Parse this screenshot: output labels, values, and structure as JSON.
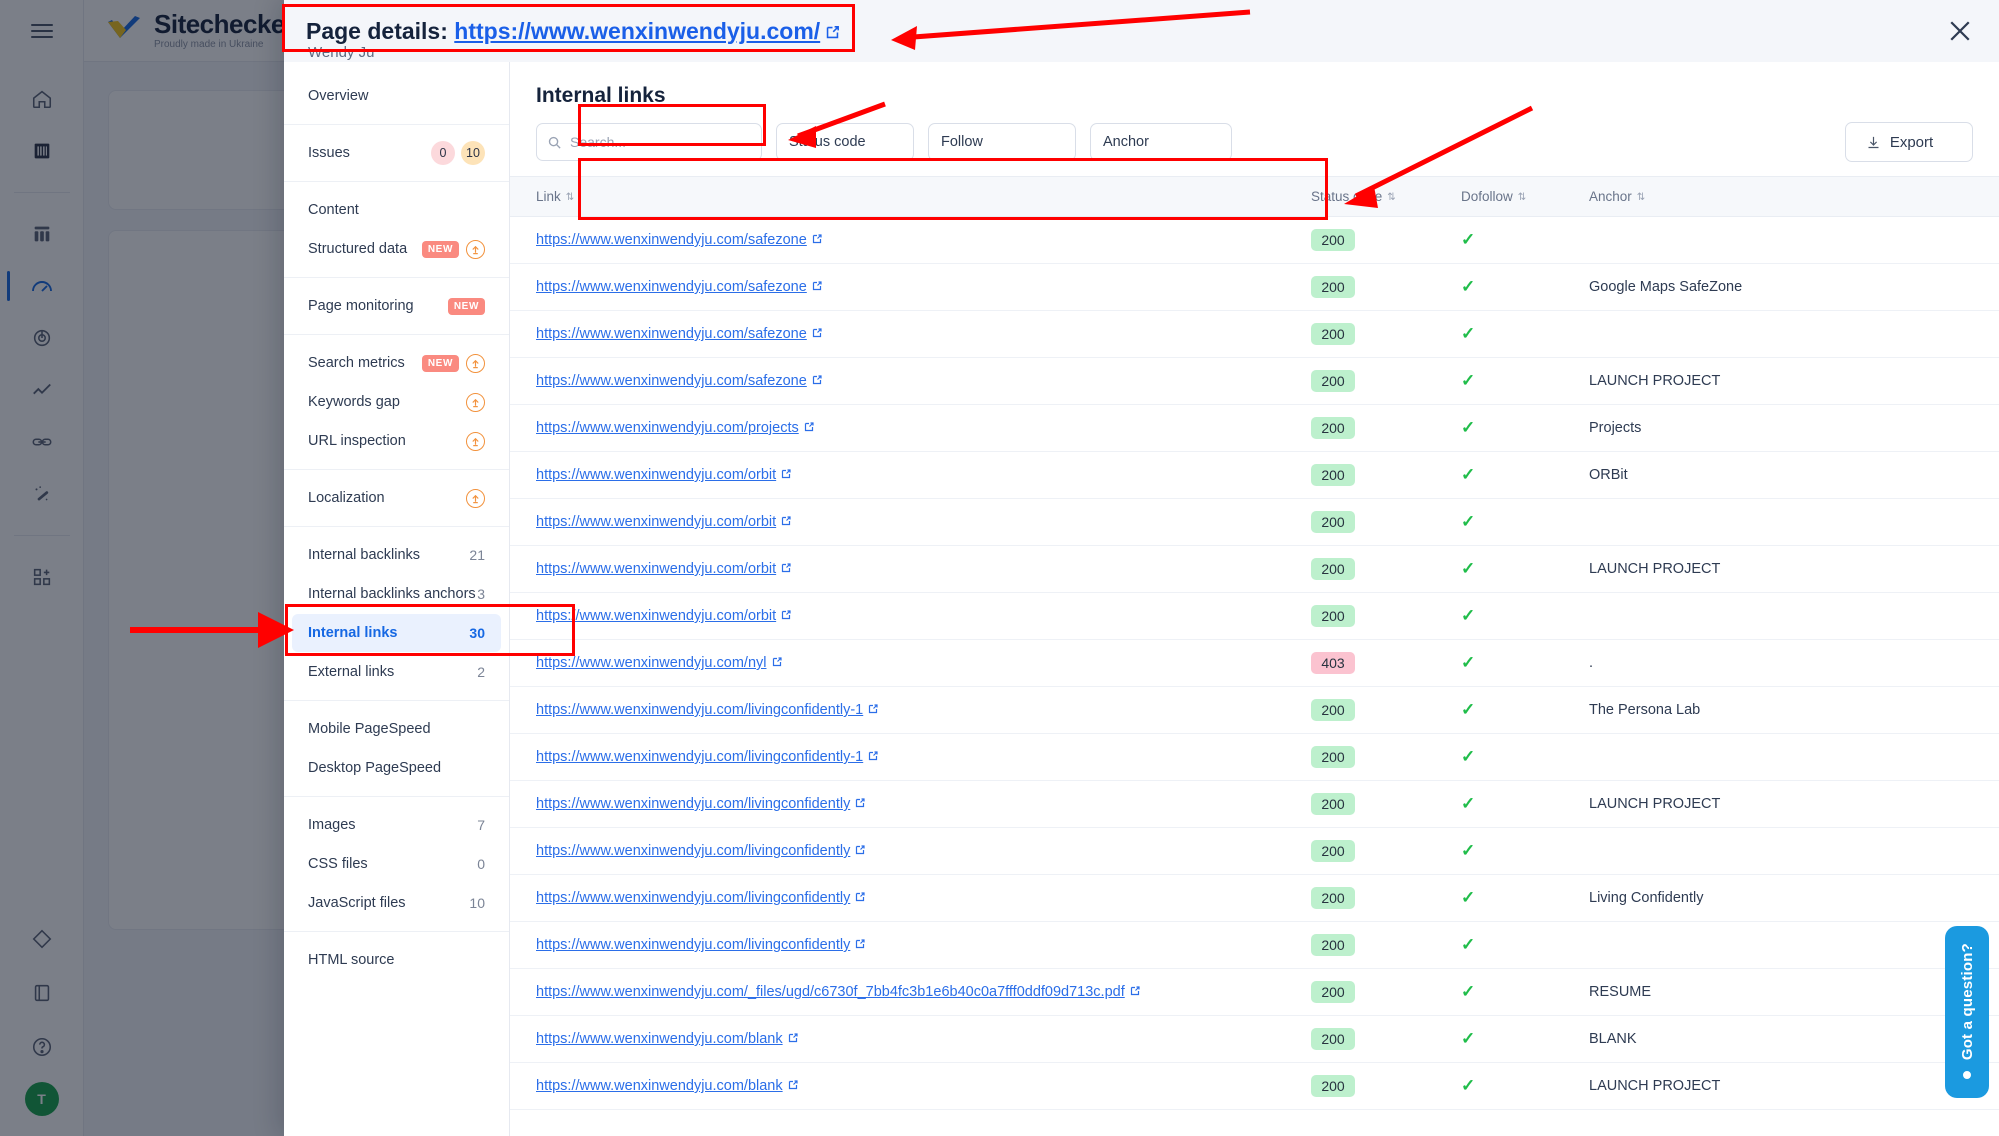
{
  "app": {
    "brand_name": "Sitechecker",
    "brand_tagline": "Proudly made in Ukraine",
    "menu_icon": "hamburger-icon",
    "avatar_initial": "T",
    "rail_icons": [
      "home-icon",
      "barcode-icon",
      "columns-icon",
      "speedometer-icon",
      "target-icon",
      "trend-line-icon",
      "link-icon",
      "magic-wand-icon",
      "add-module-icon",
      "diamond-icon",
      "book-icon",
      "help-icon"
    ]
  },
  "modal": {
    "title_prefix": "Page details:",
    "url": "https://www.wenxinwendyju.com/",
    "external_icon": "external-link-icon",
    "subtitle": "Wendy Ju",
    "close_icon": "close-icon"
  },
  "sidebar": {
    "groups": [
      {
        "items": [
          {
            "label": "Overview"
          }
        ]
      },
      {
        "items": [
          {
            "label": "Issues",
            "badges": [
              {
                "value": "0",
                "color": "#fcd9dc"
              },
              {
                "value": "10",
                "color": "#fde3b8"
              }
            ]
          }
        ]
      },
      {
        "items": [
          {
            "label": "Content"
          },
          {
            "label": "Structured data",
            "tag": "NEW",
            "upgrade": true
          }
        ]
      },
      {
        "items": [
          {
            "label": "Page monitoring",
            "tag": "NEW"
          }
        ]
      },
      {
        "items": [
          {
            "label": "Search metrics",
            "tag": "NEW",
            "upgrade": true
          },
          {
            "label": "Keywords gap",
            "upgrade": true
          },
          {
            "label": "URL inspection",
            "upgrade": true
          }
        ]
      },
      {
        "items": [
          {
            "label": "Localization",
            "upgrade": true
          }
        ]
      },
      {
        "items": [
          {
            "label": "Internal backlinks",
            "count": "21"
          },
          {
            "label": "Internal backlinks anchors",
            "count": "3"
          },
          {
            "label": "Internal links",
            "count": "30",
            "active": true
          },
          {
            "label": "External links",
            "count": "2"
          }
        ]
      },
      {
        "items": [
          {
            "label": "Mobile PageSpeed"
          },
          {
            "label": "Desktop PageSpeed"
          }
        ]
      },
      {
        "items": [
          {
            "label": "Images",
            "count": "7"
          },
          {
            "label": "CSS files",
            "count": "0"
          },
          {
            "label": "JavaScript files",
            "count": "10"
          }
        ]
      },
      {
        "items": [
          {
            "label": "HTML source"
          }
        ]
      }
    ]
  },
  "main": {
    "title": "Internal links",
    "search_placeholder": "Search...",
    "search_value": "",
    "search_icon": "search-icon",
    "filters": [
      {
        "label": "Status code",
        "name": "status-code-filter"
      },
      {
        "label": "Follow",
        "name": "follow-filter"
      },
      {
        "label": "Anchor",
        "name": "anchor-filter"
      }
    ],
    "export_label": "Export",
    "export_icon": "download-icon",
    "columns": [
      {
        "label": "Link",
        "key": "link"
      },
      {
        "label": "Status code",
        "key": "status"
      },
      {
        "label": "Dofollow",
        "key": "dofollow"
      },
      {
        "label": "Anchor",
        "key": "anchor"
      }
    ],
    "rows": [
      {
        "link": "https://www.wenxinwendyju.com/safezone",
        "status": "200",
        "dofollow": true,
        "anchor": ""
      },
      {
        "link": "https://www.wenxinwendyju.com/safezone",
        "status": "200",
        "dofollow": true,
        "anchor": "Google Maps SafeZone"
      },
      {
        "link": "https://www.wenxinwendyju.com/safezone",
        "status": "200",
        "dofollow": true,
        "anchor": ""
      },
      {
        "link": "https://www.wenxinwendyju.com/safezone",
        "status": "200",
        "dofollow": true,
        "anchor": "LAUNCH PROJECT"
      },
      {
        "link": "https://www.wenxinwendyju.com/projects",
        "status": "200",
        "dofollow": true,
        "anchor": "Projects"
      },
      {
        "link": "https://www.wenxinwendyju.com/orbit",
        "status": "200",
        "dofollow": true,
        "anchor": "ORBit"
      },
      {
        "link": "https://www.wenxinwendyju.com/orbit",
        "status": "200",
        "dofollow": true,
        "anchor": ""
      },
      {
        "link": "https://www.wenxinwendyju.com/orbit",
        "status": "200",
        "dofollow": true,
        "anchor": "LAUNCH PROJECT"
      },
      {
        "link": "https://www.wenxinwendyju.com/orbit",
        "status": "200",
        "dofollow": true,
        "anchor": ""
      },
      {
        "link": "https://www.wenxinwendyju.com/nyl",
        "status": "403",
        "dofollow": true,
        "anchor": "."
      },
      {
        "link": "https://www.wenxinwendyju.com/livingconfidently-1",
        "status": "200",
        "dofollow": true,
        "anchor": "The Persona Lab"
      },
      {
        "link": "https://www.wenxinwendyju.com/livingconfidently-1",
        "status": "200",
        "dofollow": true,
        "anchor": ""
      },
      {
        "link": "https://www.wenxinwendyju.com/livingconfidently",
        "status": "200",
        "dofollow": true,
        "anchor": "LAUNCH PROJECT"
      },
      {
        "link": "https://www.wenxinwendyju.com/livingconfidently",
        "status": "200",
        "dofollow": true,
        "anchor": ""
      },
      {
        "link": "https://www.wenxinwendyju.com/livingconfidently",
        "status": "200",
        "dofollow": true,
        "anchor": "Living Confidently"
      },
      {
        "link": "https://www.wenxinwendyju.com/livingconfidently",
        "status": "200",
        "dofollow": true,
        "anchor": ""
      },
      {
        "link": "https://www.wenxinwendyju.com/_files/ugd/c6730f_7bb4fc3b1e6b40c0a7fff0ddf09d713c.pdf",
        "status": "200",
        "dofollow": true,
        "anchor": "RESUME"
      },
      {
        "link": "https://www.wenxinwendyju.com/blank",
        "status": "200",
        "dofollow": true,
        "anchor": "BLANK"
      },
      {
        "link": "https://www.wenxinwendyju.com/blank",
        "status": "200",
        "dofollow": true,
        "anchor": "LAUNCH PROJECT"
      }
    ]
  },
  "chat_widget": {
    "label": "Got a question?"
  },
  "colors": {
    "accent_blue": "#1668e3",
    "link_blue": "#2b6ee8",
    "status_ok_bg": "#bdf0cd",
    "status_err_bg": "#fbc3d0",
    "check_green": "#20bd4a",
    "new_badge": "#fa8a80",
    "annotation_red": "#ff0000"
  }
}
